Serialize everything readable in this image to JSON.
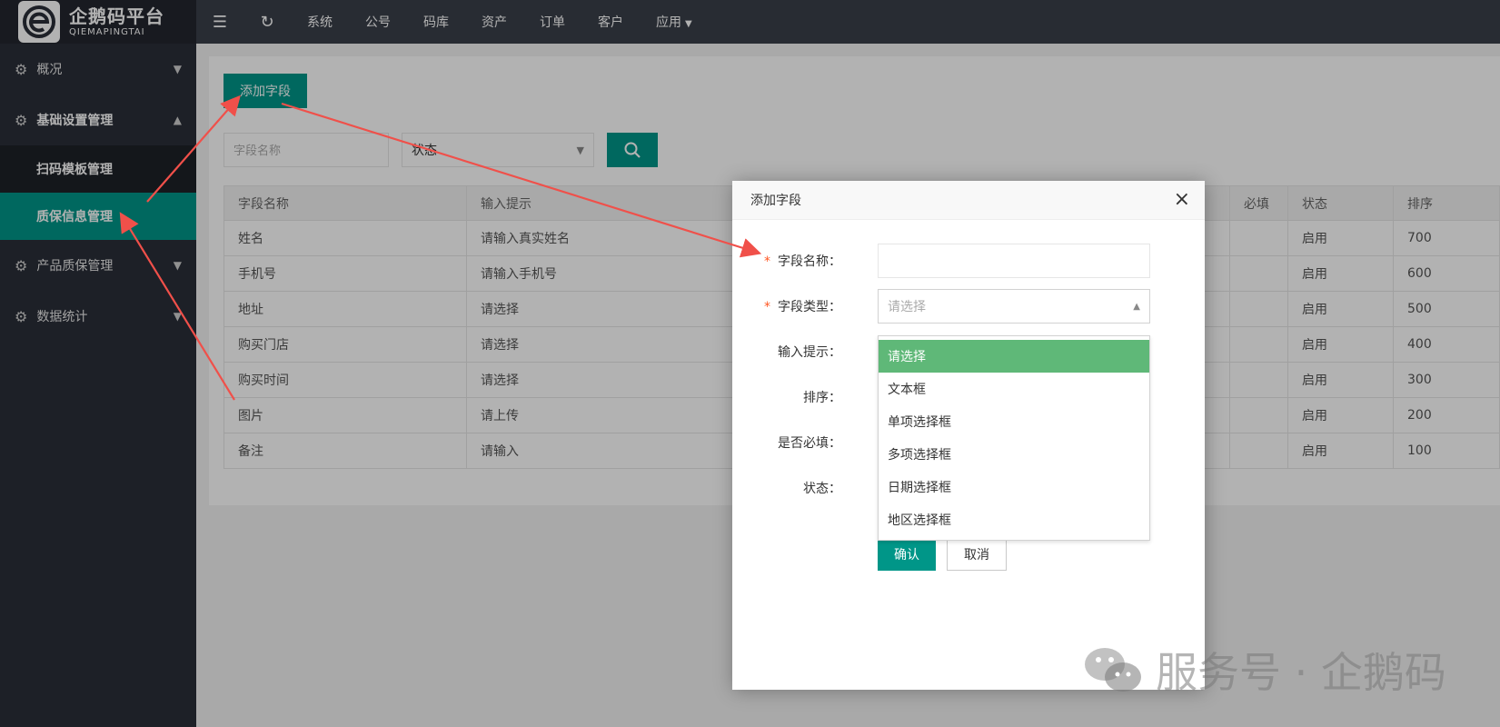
{
  "brand": {
    "name": "企鹅码平台",
    "subtitle": "QIEMAPINGTAI"
  },
  "sidebar": {
    "groups": [
      {
        "label": "概况"
      },
      {
        "label": "基础设置管理"
      },
      {
        "label": "产品质保管理"
      },
      {
        "label": "数据统计"
      }
    ],
    "subitems": [
      {
        "label": "扫码模板管理"
      },
      {
        "label": "质保信息管理"
      }
    ]
  },
  "topnav": [
    "系统",
    "公号",
    "码库",
    "资产",
    "订单",
    "客户",
    "应用"
  ],
  "toolbar": {
    "add_label": "添加字段",
    "name_placeholder": "字段名称",
    "status_label": "状态"
  },
  "table": {
    "columns": [
      "字段名称",
      "输入提示",
      "",
      "必填",
      "状态",
      "排序"
    ],
    "rows": [
      [
        "姓名",
        "请输入真实姓名",
        "",
        "",
        "启用",
        "700"
      ],
      [
        "手机号",
        "请输入手机号",
        "",
        "",
        "启用",
        "600"
      ],
      [
        "地址",
        "请选择",
        "",
        "",
        "启用",
        "500"
      ],
      [
        "购买门店",
        "请选择",
        "",
        "",
        "启用",
        "400"
      ],
      [
        "购买时间",
        "请选择",
        "",
        "",
        "启用",
        "300"
      ],
      [
        "图片",
        "请上传",
        "",
        "",
        "启用",
        "200"
      ],
      [
        "备注",
        "请输入",
        "",
        "",
        "启用",
        "100"
      ]
    ]
  },
  "dialog": {
    "title": "添加字段",
    "close": "×",
    "labels": {
      "name": "字段名称：",
      "type": "字段类型：",
      "hint": "输入提示：",
      "sort": "排序：",
      "required": "是否必填：",
      "status": "状态："
    },
    "required_mark": "*",
    "type_placeholder": "请选择",
    "type_options": [
      "请选择",
      "文本框",
      "单项选择框",
      "多项选择框",
      "日期选择框",
      "地区选择框"
    ],
    "confirm": "确认",
    "cancel": "取消"
  },
  "watermark": "服务号 · 企鹅码",
  "colors": {
    "accent": "#009688",
    "selected": "#5fb878",
    "sidebar": "#2a2e38",
    "arrow": "#f0504a"
  }
}
